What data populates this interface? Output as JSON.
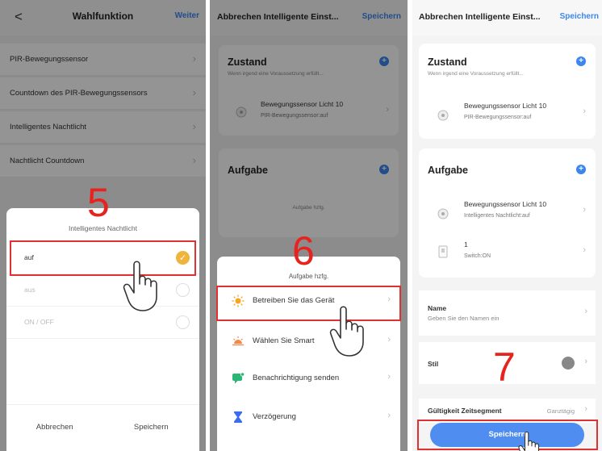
{
  "panel1": {
    "header": {
      "back": "<",
      "title": "Wahlfunktion",
      "next": "Weiter"
    },
    "rows": [
      {
        "label": "PIR-Bewegungssensor"
      },
      {
        "label": "Countdown des PIR-Bewegungssensors"
      },
      {
        "label": "Intelligentes Nachtlicht"
      },
      {
        "label": "Nachtlicht Countdown"
      }
    ],
    "step": "5",
    "sheet": {
      "title": "Intelligentes Nachtlicht",
      "options": [
        {
          "label": "auf",
          "selected": true
        },
        {
          "label": "aus",
          "selected": false
        },
        {
          "label": "ON / OFF",
          "selected": false
        }
      ],
      "cancel": "Abbrechen",
      "save": "Speichern"
    }
  },
  "panel2": {
    "header": {
      "title": "Abbrechen Intelligente Einst...",
      "save": "Speichern"
    },
    "condition": {
      "title": "Zustand",
      "subtitle": "Wenn irgend eine Voraussetzung erfüllt...",
      "item_title": "Bewegungssensor Licht 10",
      "item_sub": "PIR-Bewegungssensor:auf"
    },
    "task": {
      "title": "Aufgabe",
      "placeholder": "Aufgabe hzfg."
    },
    "step": "6",
    "sheet": {
      "title": "Aufgabe hzfg.",
      "items": [
        {
          "label": "Betreiben Sie das Gerät",
          "icon": "sun-icon"
        },
        {
          "label": "Wählen Sie Smart",
          "icon": "sunrise-icon"
        },
        {
          "label": "Benachrichtigung senden",
          "icon": "notification-icon"
        },
        {
          "label": "Verzögerung",
          "icon": "hourglass-icon"
        }
      ]
    }
  },
  "panel3": {
    "header": {
      "title": "Abbrechen Intelligente Einst...",
      "save": "Speichern"
    },
    "condition": {
      "title": "Zustand",
      "subtitle": "Wenn irgend eine Voraussetzung erfüllt...",
      "item_title": "Bewegungssensor Licht 10",
      "item_sub": "PIR-Bewegungssensor:auf"
    },
    "task": {
      "title": "Aufgabe",
      "items": [
        {
          "title": "Bewegungssensor Licht 10",
          "sub": "Intelligentes Nachtlicht:auf"
        },
        {
          "title": "1",
          "sub": "Switch:ON"
        }
      ]
    },
    "name": {
      "label": "Name",
      "sub": "Geben Sie den Namen ein"
    },
    "style": {
      "label": "Stil"
    },
    "validity": {
      "label": "Gültigkeit Zeitsegment",
      "value": "Ganztägig"
    },
    "step": "7",
    "save_button": "Speichern"
  },
  "colors": {
    "accent": "#3b86f0",
    "annotation": "#e8231e",
    "selected": "#f0b43a"
  }
}
